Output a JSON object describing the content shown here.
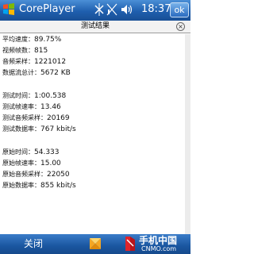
{
  "window": {
    "app_title": "CorePlayer",
    "clock": "18:37",
    "ok_label": "ok"
  },
  "dialog": {
    "title": "测试结果",
    "close_glyph": "×"
  },
  "stats": [
    {
      "label": "平均速度：",
      "value": "89.75%"
    },
    {
      "label": "视频帧数：",
      "value": "815"
    },
    {
      "label": "音频采样：",
      "value": "1221012"
    },
    {
      "label": "数据流总计：",
      "value": "5672 KB"
    },
    {
      "label": "测试时间：",
      "value": "1:00.538"
    },
    {
      "label": "测试帧速率：",
      "value": "13.46"
    },
    {
      "label": "测试音频采样：",
      "value": "20169"
    },
    {
      "label": "测试数据率：",
      "value": "767 kbit/s"
    },
    {
      "label": "原始时间：",
      "value": "54.333"
    },
    {
      "label": "原始帧速率：",
      "value": "15.00"
    },
    {
      "label": "原始音频采样：",
      "value": "22050"
    },
    {
      "label": "原始数据率：",
      "value": "855 kbit/s"
    }
  ],
  "bottom_bar": {
    "close_label": "关闭"
  },
  "watermark": {
    "main_text": "手机中国",
    "sub_text": "CNMO.com"
  },
  "icons": [
    "windows-start-icon",
    "connectivity-icon",
    "signal-icon",
    "volume-icon",
    "close-icon",
    "coreplayer-logo-icon",
    "cnmo-logo-icon"
  ]
}
